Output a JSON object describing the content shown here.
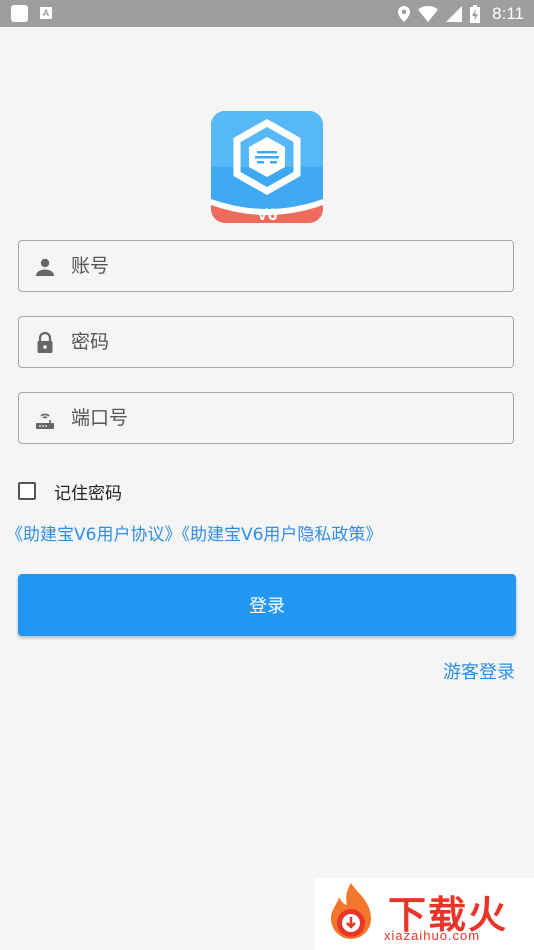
{
  "status_bar": {
    "time": "8:11"
  },
  "app": {
    "logo_badge": "V6"
  },
  "form": {
    "account_placeholder": "账号",
    "password_placeholder": "密码",
    "port_placeholder": "端口号",
    "remember_label": "记住密码",
    "remember_checked": false
  },
  "agreements": {
    "user_agreement": "《助建宝V6用户协议》",
    "privacy_policy": "《助建宝V6用户隐私政策》"
  },
  "buttons": {
    "login_label": "登录",
    "guest_login_label": "游客登录"
  },
  "watermark": {
    "text": "下载火",
    "url": "xiazaihuo.com"
  },
  "colors": {
    "primary": "#2196f3",
    "link": "#2f8fe6",
    "logo_badge": "#f06a5e",
    "background": "#f5f5f5"
  }
}
